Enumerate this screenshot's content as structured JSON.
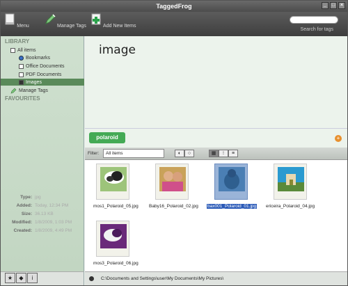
{
  "window": {
    "title": "TaggedFrog"
  },
  "toolbar": {
    "menu": "Menu",
    "manage_tags": "Manage Tags",
    "add_new_items": "Add New Items",
    "search_label": "Search for tags",
    "search_value": ""
  },
  "sidebar": {
    "library_heading": "LIBRARY",
    "items": [
      {
        "label": "All items"
      },
      {
        "label": "Bookmarks"
      },
      {
        "label": "Office Documents"
      },
      {
        "label": "PDF Documents"
      },
      {
        "label": "Images"
      }
    ],
    "manage_tags": "Manage Tags",
    "favourites_heading": "FAVOURITES"
  },
  "info": {
    "type_k": "Type:",
    "type_v": "jpg",
    "added_k": "Added:",
    "added_v": "Today, 12:34 PM",
    "size_k": "Size:",
    "size_v": "36.13 KB",
    "modified_k": "Modified:",
    "modified_v": "1/8/2009, 1:03 PM",
    "created_k": "Created:",
    "created_v": "1/8/2009, 4:49 PM"
  },
  "preview": {
    "title": "image"
  },
  "tags": {
    "pill": "polaroid"
  },
  "filter": {
    "label": "Filter:",
    "value": "All items"
  },
  "files": [
    {
      "name": "mos1_Polaroid_05.jpg"
    },
    {
      "name": "Baby16_Polaroid_02.jpg"
    },
    {
      "name": "bax001_Polaroid_01.jpg"
    },
    {
      "name": "ericeira_Polaroid_04.jpg"
    },
    {
      "name": "mos3_Polaroid_06.jpg"
    }
  ],
  "status": {
    "path": "C:\\Documents and Settings\\user\\My Documents\\My Pictures\\"
  },
  "colors": {
    "accent_green": "#44aa55",
    "selection_blue": "#2a5ab8",
    "toolbar_dark": "#4c4c4c"
  }
}
